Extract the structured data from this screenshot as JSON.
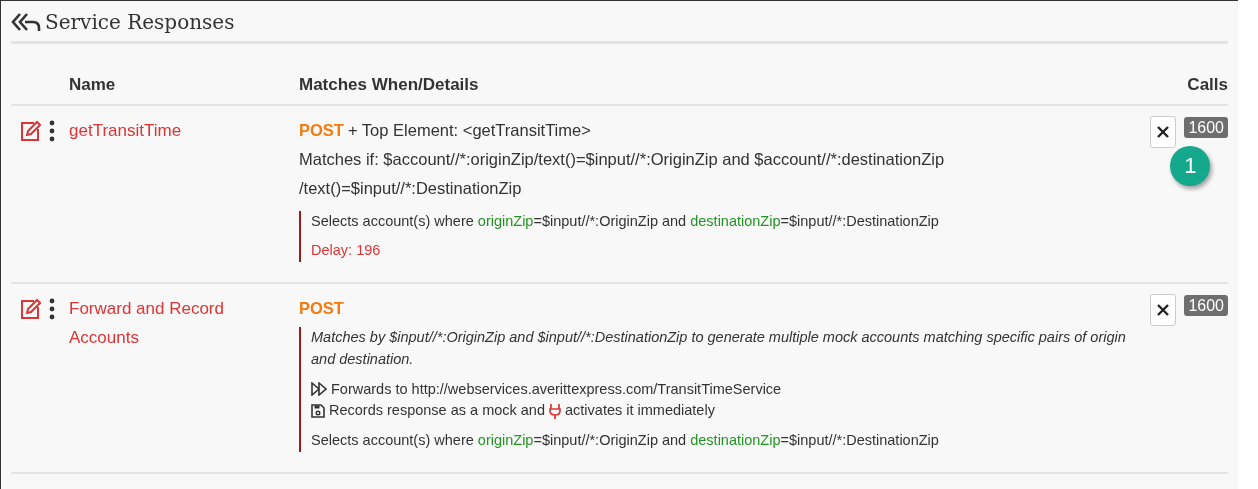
{
  "title": "Service Responses",
  "columns": [
    "Name",
    "Matches When/Details",
    "Calls"
  ],
  "rows": [
    {
      "name": "getTransitTime",
      "method": "POST",
      "method_suffix": "+ Top Element: <getTransitTime>",
      "matches": "Matches if: $account//*:originZip/text()=$input//*:OriginZip and $account//*:destinationZip /text()=$input//*:DestinationZip",
      "calls": "1600",
      "callout": "1",
      "details": [
        {
          "kind": "selects",
          "segments": [
            {
              "kind": "plain",
              "text": "Selects account(s) where "
            },
            {
              "kind": "field",
              "text": "originZip"
            },
            {
              "kind": "plain",
              "text": "=$input//*:OriginZip and "
            },
            {
              "kind": "field",
              "text": "destinationZip"
            },
            {
              "kind": "plain",
              "text": "=$input//*:DestinationZip"
            }
          ]
        },
        {
          "kind": "delay",
          "text": "Delay: 196"
        }
      ]
    },
    {
      "name": "Forward and Record Accounts",
      "method": "POST",
      "calls": "1600",
      "details": [
        {
          "kind": "note",
          "text": "Matches by $input//*:OriginZip and $input//*:DestinationZip to generate multiple mock accounts matching specific pairs of origin and destination."
        },
        {
          "kind": "forward",
          "text": "Forwards to http://webservices.averittexpress.com/TransitTimeService"
        },
        {
          "kind": "record",
          "text": "Records response as a mock and",
          "after": "activates it immediately"
        },
        {
          "kind": "selects",
          "segments": [
            {
              "kind": "plain",
              "text": "Selects account(s) where "
            },
            {
              "kind": "field",
              "text": "originZip"
            },
            {
              "kind": "plain",
              "text": "=$input//*:OriginZip and "
            },
            {
              "kind": "field",
              "text": "destinationZip"
            },
            {
              "kind": "plain",
              "text": "=$input//*:DestinationZip"
            }
          ]
        }
      ]
    }
  ]
}
